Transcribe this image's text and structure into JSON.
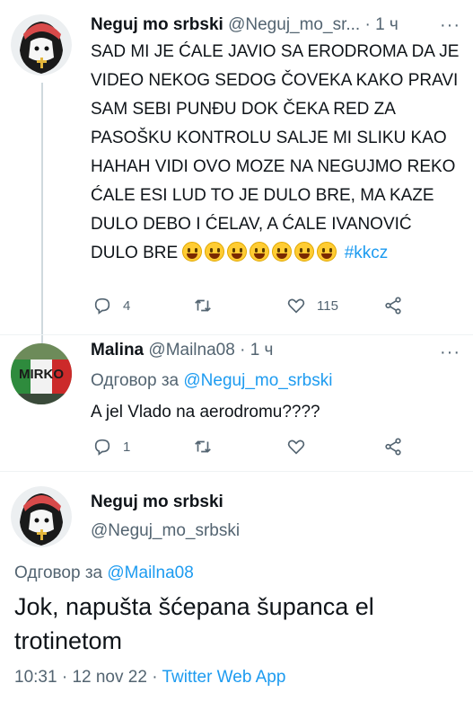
{
  "tweet1": {
    "display_name": "Neguj mo srbski",
    "handle": "@Neguj_mo_sr...",
    "separator": "·",
    "time": "1 ч",
    "more": "···",
    "text": "SAD MI JE ĆALE JAVIO SA ERODROMA DA JE VIDEO NEKOG SEDOG ČOVEKA KAKO PRAVI SAM SEBI PUNĐU DOK ČEKA RED ZA PASOŠKU KONTROLU SALJE MI SLIKU KAO HAHAH VIDI OVO MOZE NA NEGUJMO REKO ĆALE ESI LUD TO JE DULO BRE, MA KAZE DULO DEBO I ĆELAV, A ĆALE IVANOVIĆ DULO BRE",
    "emojis": [
      "smiley-emoji",
      "laughing-emoji",
      "smiley-emoji",
      "grinning-emoji",
      "smiley-emoji",
      "laughing-emoji",
      "smiley-emoji"
    ],
    "hashtag": "#kkcz",
    "replies": "4",
    "retweets": "",
    "likes": "115"
  },
  "tweet2": {
    "display_name": "Malina",
    "handle": "@Mailna08",
    "separator": "·",
    "time": "1 ч",
    "more": "···",
    "reply_prefix": "Одговор за",
    "reply_mention": "@Neguj_mo_srbski",
    "text": "A jel Vlado na aerodromu????",
    "avatar_text": "MIRKO",
    "replies": "1",
    "retweets": "",
    "likes": ""
  },
  "tweet3": {
    "display_name": "Neguj mo srbski",
    "handle": "@Neguj_mo_srbski",
    "reply_prefix": "Одговор за",
    "reply_mention": "@Mailna08",
    "text": "Jok, napušta šćepana šupanca el trotinetom",
    "time": "10:31",
    "date": "12 nov 22",
    "separator": "·",
    "source": "Twitter Web App"
  },
  "colors": {
    "accent": "#1d9bf0",
    "secondary_text": "#536471",
    "primary_text": "#0f1419"
  }
}
